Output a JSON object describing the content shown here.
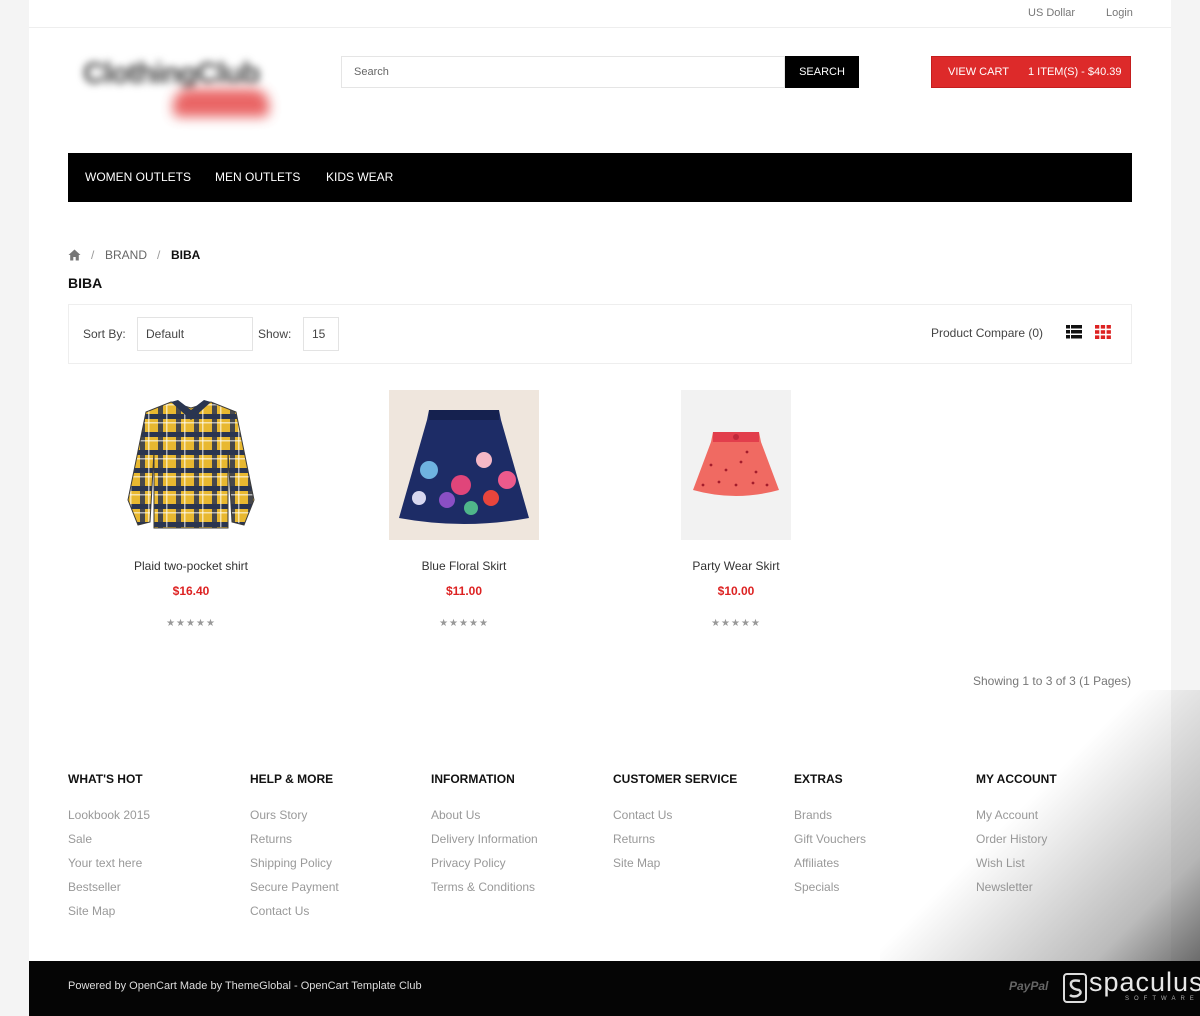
{
  "topbar": {
    "currency": "US Dollar",
    "login": "Login"
  },
  "logo": {
    "text": "ClothingClub"
  },
  "search": {
    "placeholder": "Search",
    "button": "SEARCH"
  },
  "cart": {
    "view_label": "VIEW CART",
    "summary": "1 ITEM(S) - $40.39"
  },
  "nav": [
    "WOMEN OUTLETS",
    "MEN OUTLETS",
    "KIDS WEAR"
  ],
  "breadcrumb": {
    "home_icon": "home-icon",
    "items": [
      "BRAND",
      "BIBA"
    ]
  },
  "page_title": "BIBA",
  "toolbar": {
    "sort_label": "Sort By:",
    "sort_value": "Default",
    "show_label": "Show:",
    "show_value": "15",
    "compare": "Product Compare (0)",
    "views": [
      "list-view-icon",
      "grid-view-icon"
    ]
  },
  "products": [
    {
      "name": "Plaid two-pocket shirt",
      "price": "$16.40",
      "stars": "★★★★★"
    },
    {
      "name": "Blue Floral Skirt",
      "price": "$11.00",
      "stars": "★★★★★"
    },
    {
      "name": "Party Wear Skirt",
      "price": "$10.00",
      "stars": "★★★★★"
    }
  ],
  "results": "Showing 1 to 3 of 3 (1 Pages)",
  "footer": {
    "columns": [
      {
        "title": "WHAT'S HOT",
        "links": [
          "Lookbook 2015",
          "Sale",
          "Your text here",
          "Bestseller",
          "Site Map"
        ]
      },
      {
        "title": "HELP & MORE",
        "links": [
          "Ours Story",
          "Returns",
          "Shipping Policy",
          "Secure Payment",
          "Contact Us"
        ]
      },
      {
        "title": "INFORMATION",
        "links": [
          "About Us",
          "Delivery Information",
          "Privacy Policy",
          "Terms & Conditions"
        ]
      },
      {
        "title": "CUSTOMER SERVICE",
        "links": [
          "Contact Us",
          "Returns",
          "Site Map"
        ]
      },
      {
        "title": "EXTRAS",
        "links": [
          "Brands",
          "Gift Vouchers",
          "Affiliates",
          "Specials"
        ]
      },
      {
        "title": "MY ACCOUNT",
        "links": [
          "My Account",
          "Order History",
          "Wish List",
          "Newsletter"
        ]
      }
    ],
    "powered": "Powered by OpenCart Made by ThemeGlobal - OpenCart Template Club",
    "paypal": "PayPal",
    "watermark": {
      "word": "spaculus",
      "sub": "SOFTWARE"
    }
  }
}
